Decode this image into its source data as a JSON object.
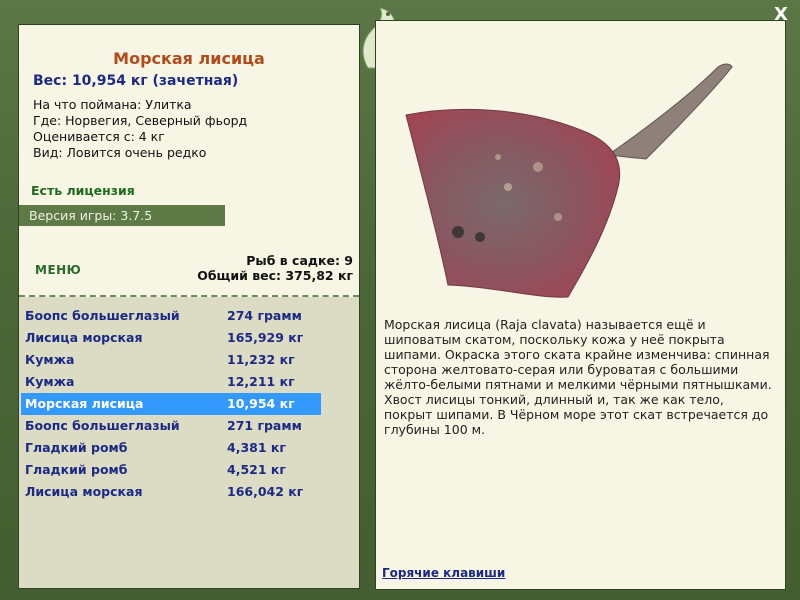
{
  "window": {
    "close_label": "X"
  },
  "fish": {
    "title": "Морская лисица",
    "weight_line": "Вес: 10,954 кг (зачетная)",
    "caught_on": "На что поймана: Улитка",
    "location": "Где: Норвегия, Северный фьорд",
    "rating": "Оценивается с: 4 кг",
    "rarity": "Вид: Ловится очень редко"
  },
  "license": {
    "label": "Есть лицензия"
  },
  "version": {
    "label": "Версия игры: 3.7.5"
  },
  "menu": {
    "label": "МЕНЮ"
  },
  "stats": {
    "fish_count": "Рыб в садке: 9",
    "total_weight": "Общий вес: 375,82 кг"
  },
  "catch_list": [
    {
      "name": "Боопс большеглазый",
      "weight": "274 грамм"
    },
    {
      "name": "Лисица морская",
      "weight": "165,929 кг"
    },
    {
      "name": "Кумжа",
      "weight": "11,232 кг"
    },
    {
      "name": "Кумжа",
      "weight": "12,211 кг"
    },
    {
      "name": "Морская лисица",
      "weight": "10,954 кг"
    },
    {
      "name": "Боопс большеглазый",
      "weight": "271 грамм"
    },
    {
      "name": "Гладкий ромб",
      "weight": "4,381 кг"
    },
    {
      "name": "Гладкий ромб",
      "weight": "4,521 кг"
    },
    {
      "name": "Лисица морская",
      "weight": "166,042 кг"
    }
  ],
  "selected_index": 4,
  "description": {
    "text": "Морская лисица (Raja clavata) называется ещё и шиповатым скатом, поскольку кожа у неё покрыта шипами. Окраска этого ската крайне изменчива: спинная сторона желтовато-серая или буроватая с большими жёлто-белыми пятнами и мелкими чёрными пятнышками. Хвост лисицы тонкий, длинный и, так же как тело, покрыт шипами. В Чёрном море этот скат встречается до глубины 100 м."
  },
  "hotkeys": {
    "label": "Горячие клавиши"
  },
  "colors": {
    "title": "#b24a1b",
    "accent_blue": "#1c2a86",
    "selected_row": "#3399ff",
    "panel_bg": "#f7f6e4",
    "frame": "#4f6b3c"
  }
}
